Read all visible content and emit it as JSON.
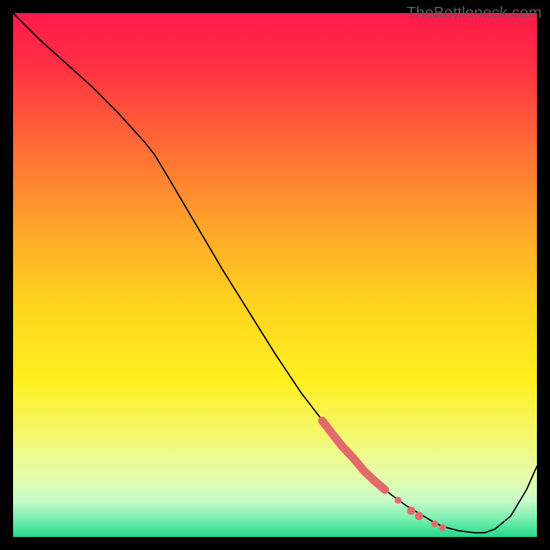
{
  "watermark": "TheBottleneck.com",
  "chart_data": {
    "type": "line",
    "title": "",
    "xlabel": "",
    "ylabel": "",
    "xlim": [
      0,
      100
    ],
    "ylim": [
      0,
      100
    ],
    "background_gradient": {
      "stops": [
        {
          "offset": 0.0,
          "color": "#ff1a4a"
        },
        {
          "offset": 0.1,
          "color": "#ff2f44"
        },
        {
          "offset": 0.25,
          "color": "#ff6a35"
        },
        {
          "offset": 0.4,
          "color": "#ffa22a"
        },
        {
          "offset": 0.55,
          "color": "#ffd21f"
        },
        {
          "offset": 0.7,
          "color": "#ffef1f"
        },
        {
          "offset": 0.8,
          "color": "#f5f86a"
        },
        {
          "offset": 0.88,
          "color": "#e8fca8"
        },
        {
          "offset": 0.93,
          "color": "#c9fcc9"
        },
        {
          "offset": 0.965,
          "color": "#7af0b0"
        },
        {
          "offset": 1.0,
          "color": "#22d88a"
        }
      ]
    },
    "series": [
      {
        "name": "curve",
        "color": "#000000",
        "stroke_width": 2,
        "x": [
          0,
          5,
          10,
          15,
          20,
          25,
          27,
          30,
          35,
          40,
          45,
          50,
          55,
          60,
          65,
          68,
          70,
          72,
          75,
          78,
          80,
          82,
          85,
          88,
          90,
          92,
          95,
          98,
          100
        ],
        "y": [
          100,
          95,
          90.5,
          86,
          81,
          75.5,
          73,
          68,
          59.5,
          51,
          43,
          35,
          27.5,
          21,
          15,
          12,
          10,
          8.2,
          6.0,
          4.2,
          3.0,
          2.0,
          1.2,
          0.8,
          0.8,
          1.5,
          4.0,
          9.0,
          13.5
        ]
      },
      {
        "name": "highlight-thick",
        "color": "#e36a6a",
        "stroke_width": 12,
        "x": [
          59,
          61,
          63,
          65,
          67,
          69,
          71
        ],
        "y": [
          22.2,
          19.6,
          17.1,
          15.0,
          12.6,
          10.7,
          9.0
        ]
      }
    ],
    "markers": [
      {
        "x": 73.5,
        "y": 7.0,
        "r": 5,
        "color": "#e36a6a",
        "name": "marker"
      },
      {
        "x": 76.0,
        "y": 5.0,
        "r": 6,
        "color": "#e36a6a",
        "name": "marker"
      },
      {
        "x": 77.5,
        "y": 4.0,
        "r": 6,
        "color": "#e36a6a",
        "name": "marker"
      },
      {
        "x": 80.5,
        "y": 2.5,
        "r": 5,
        "color": "#e36a6a",
        "name": "marker"
      },
      {
        "x": 82.0,
        "y": 1.8,
        "r": 5,
        "color": "#e36a6a",
        "name": "marker"
      }
    ]
  }
}
